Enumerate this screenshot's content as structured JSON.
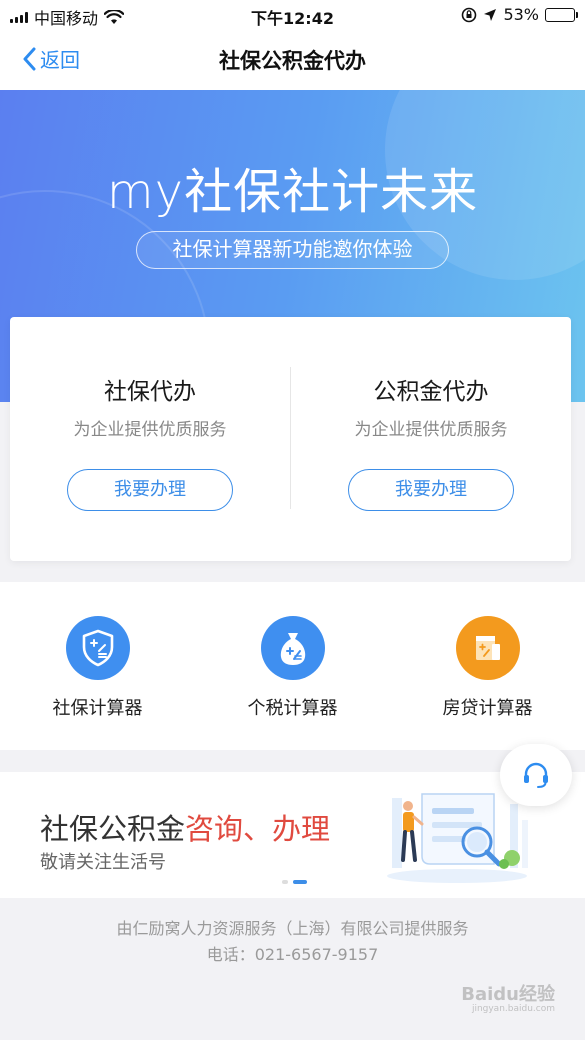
{
  "status_bar": {
    "carrier": "中国移动",
    "time": "下午12:42",
    "battery": "53%"
  },
  "nav": {
    "back_label": "返回",
    "title": "社保公积金代办"
  },
  "banner": {
    "headline": "my社保社计未来",
    "subtitle": "社保计算器新功能邀你体验"
  },
  "services": [
    {
      "title": "社保代办",
      "desc": "为企业提供优质服务",
      "button": "我要办理"
    },
    {
      "title": "公积金代办",
      "desc": "为企业提供优质服务",
      "button": "我要办理"
    }
  ],
  "calculators": [
    {
      "label": "社保计算器",
      "icon": "shield-calculator-icon",
      "color": "#3f8ff0"
    },
    {
      "label": "个税计算器",
      "icon": "money-bag-calculator-icon",
      "color": "#3f8ff0"
    },
    {
      "label": "房贷计算器",
      "icon": "house-calculator-icon",
      "color": "#f39a1e"
    }
  ],
  "promo": {
    "title_main": "社保公积金",
    "title_highlight": "咨询、办理",
    "subtitle": "敬请关注生活号"
  },
  "footer": {
    "line1": "由仁励窝人力资源服务（上海）有限公司提供服务",
    "line2": "电话：021-6567-9157"
  },
  "watermark": {
    "text": "Baidu经验",
    "sub": "jingyan.baidu.com"
  },
  "colors": {
    "accent": "#3d8ee8",
    "highlight": "#e04a3f",
    "orange": "#f39a1e"
  }
}
